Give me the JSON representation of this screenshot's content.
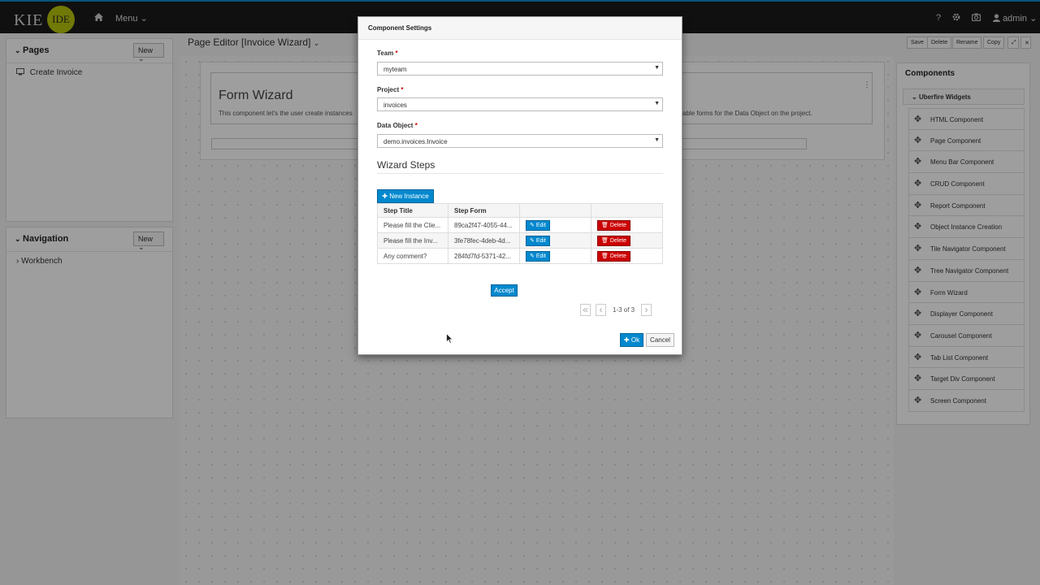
{
  "topbar": {
    "logo_kie": "KIE",
    "logo_ide": "IDE",
    "menu_label": "Menu",
    "help": "?",
    "admin_label": "admin"
  },
  "pages_panel": {
    "title": "Pages",
    "new_label": "New",
    "items": [
      "Create Invoice"
    ]
  },
  "navigation_panel": {
    "title": "Navigation",
    "new_label": "New",
    "items": [
      "Workbench"
    ]
  },
  "editor": {
    "title": "Page Editor [Invoice Wizard]",
    "toolbar": [
      "Save",
      "Delete",
      "Rename",
      "Copy"
    ],
    "form_wizard_title": "Form Wizard",
    "form_wizard_desc": "This component let's the user create instances",
    "form_wizard_desc_tail": "able forms for the Data Object on the project."
  },
  "components": {
    "title": "Components",
    "group": "Uberfire Widgets",
    "items": [
      "HTML Component",
      "Page Component",
      "Menu Bar Component",
      "CRUD Component",
      "Report Component",
      "Object Instance Creation",
      "Tile Navigator Component",
      "Tree Navigator Component",
      "Form Wizard",
      "Displayer Component",
      "Carousel Component",
      "Tab List Component",
      "Target Div Component",
      "Screen Component"
    ]
  },
  "modal": {
    "title": "Component Settings",
    "team_label": "Team",
    "team_value": "myteam",
    "project_label": "Project",
    "project_value": "invoices",
    "data_object_label": "Data Object",
    "data_object_value": "demo.invoices.Invoice",
    "required_mark": "*",
    "wizard_steps_title": "Wizard Steps",
    "new_instance_label": "New Instance",
    "table": {
      "headers": [
        "Step Title",
        "Step Form",
        "",
        ""
      ],
      "rows": [
        {
          "title": "Please fill the Clie...",
          "form": "89ca2f47-4055-44...",
          "edit": "Edit",
          "delete": "Delete"
        },
        {
          "title": "Please fill the Inv...",
          "form": "3fe78fec-4deb-4d...",
          "edit": "Edit",
          "delete": "Delete"
        },
        {
          "title": "Any comment?",
          "form": "284fd7fd-5371-42...",
          "edit": "Edit",
          "delete": "Delete"
        }
      ]
    },
    "accept_label": "Accept",
    "pager": {
      "first": "«",
      "prev": "‹",
      "range": "1-3 of 3",
      "next": "›"
    },
    "ok_label": "Ok",
    "cancel_label": "Cancel"
  }
}
